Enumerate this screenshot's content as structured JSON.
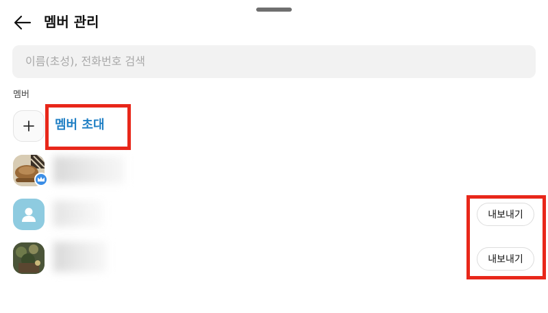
{
  "header": {
    "title": "멤버 관리",
    "back_icon": "arrow-left-icon"
  },
  "search": {
    "placeholder": "이름(초성), 전화번호 검색"
  },
  "members_section": {
    "label": "멤버",
    "invite_label": "멤버 초대",
    "invite_icon": "plus-icon",
    "rows": [
      {
        "role_badge": "crown-icon",
        "export_label": ""
      },
      {
        "export_label": "내보내기"
      },
      {
        "export_label": "내보내기"
      }
    ]
  },
  "colors": {
    "accent": "#1f7fc4",
    "highlight": "#e8271a",
    "badge": "#3b8ee6"
  }
}
